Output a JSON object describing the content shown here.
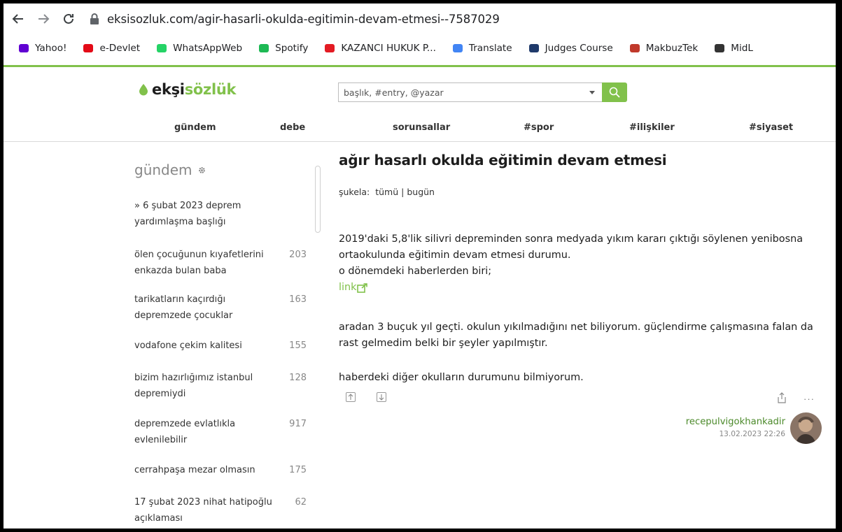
{
  "browser": {
    "url_host": "eksisozluk.com",
    "url_path": "/agir-hasarli-okulda-egitimin-devam-etmesi--7587029",
    "bookmarks": [
      {
        "label": "Yahoo!",
        "icon": "yahoo-mail-icon",
        "color": "#6001d2"
      },
      {
        "label": "e-Devlet",
        "icon": "e-devlet-icon",
        "color": "#e30a17"
      },
      {
        "label": "WhatsAppWeb",
        "icon": "whatsapp-icon",
        "color": "#25d366"
      },
      {
        "label": "Spotify",
        "icon": "spotify-icon",
        "color": "#1db954"
      },
      {
        "label": "KAZANCI HUKUK P...",
        "icon": "kazanci-icon",
        "color": "#e31b23"
      },
      {
        "label": "Translate",
        "icon": "google-translate-icon",
        "color": "#4285f4"
      },
      {
        "label": "Judges Course",
        "icon": "judges-course-icon",
        "color": "#1f3a6b"
      },
      {
        "label": "MakbuzTek",
        "icon": "makbuztek-icon",
        "color": "#c0392b"
      },
      {
        "label": "MidL",
        "icon": "midl-icon",
        "color": "#333333"
      }
    ]
  },
  "site": {
    "logo_a": "ekşi",
    "logo_b": "sözlük",
    "search_placeholder": "başlık, #entry, @yazar",
    "nav": [
      "gündem",
      "debe",
      "sorunsallar",
      "#spor",
      "#ilişkiler",
      "#siyaset"
    ],
    "accent": "#81c14b"
  },
  "sidebar": {
    "title": "gündem",
    "items": [
      {
        "title": "» 6 şubat 2023 deprem yardımlaşma başlığı",
        "count": ""
      },
      {
        "title": "ölen çocuğunun kıyafetlerini enkazda bulan baba",
        "count": "203"
      },
      {
        "title": "tarikatların kaçırdığı depremzede çocuklar",
        "count": "163"
      },
      {
        "title": "vodafone çekim kalitesi",
        "count": "155"
      },
      {
        "title": "bizim hazırlığımız istanbul depremiydi",
        "count": "128"
      },
      {
        "title": "depremzede evlatlıkla evlenilebilir",
        "count": "917"
      },
      {
        "title": "cerrahpaşa mezar olmasın",
        "count": "175"
      },
      {
        "title": "17 şubat 2023 nihat hatipoğlu açıklaması",
        "count": "62"
      }
    ]
  },
  "entry": {
    "title": "ağır hasarlı okulda eğitimin devam etmesi",
    "sukela_label": "şukela:",
    "sukela_all": "tümü",
    "sukela_sep": "|",
    "sukela_today": "bugün",
    "para1_line1": "2019'daki 5,8'lik silivri depreminden sonra medyada yıkım kararı çıktığı söylenen yenibosna",
    "para1_line2": "ortaokulunda eğitimin devam etmesi durumu.",
    "para1_line3": "o dönemdeki haberlerden biri;",
    "link_text": "link",
    "para2_line1": "aradan 3 buçuk yıl geçti. okulun yıkılmadığını net biliyorum. güçlendirme çalışmasına falan da",
    "para2_line2": "rast gelmedim belki bir şeyler yapılmıştır.",
    "para3": "haberdeki diğer okulların durumunu bilmiyorum.",
    "more": "···",
    "author": "recepulvigokhankadir",
    "date": "13.02.2023 22:26"
  }
}
